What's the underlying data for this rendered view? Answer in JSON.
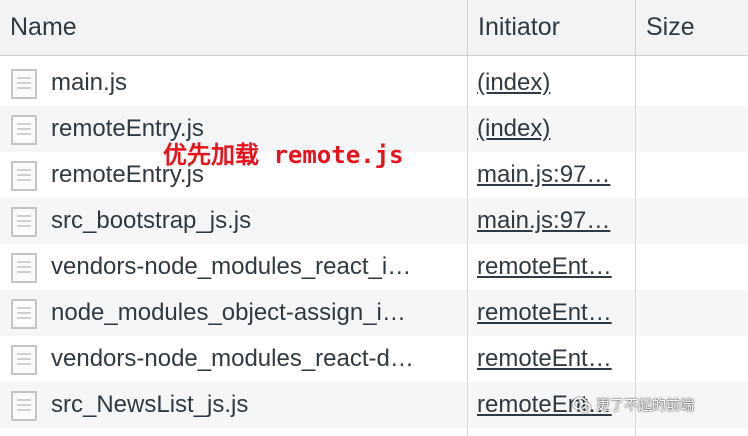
{
  "columns": {
    "name": "Name",
    "initiator": "Initiator",
    "size": "Size"
  },
  "rows": [
    {
      "name": "main.js",
      "initiator": "(index)",
      "size": ""
    },
    {
      "name": "remoteEntry.js",
      "initiator": "(index)",
      "size": ""
    },
    {
      "name": "remoteEntry.js",
      "initiator": "main.js:97…",
      "size": ""
    },
    {
      "name": "src_bootstrap_js.js",
      "initiator": "main.js:97…",
      "size": ""
    },
    {
      "name": "vendors-node_modules_react_i…",
      "initiator": "remoteEnt…",
      "size": ""
    },
    {
      "name": "node_modules_object-assign_i…",
      "initiator": "remoteEnt…",
      "size": ""
    },
    {
      "name": "vendors-node_modules_react-d…",
      "initiator": "remoteEnt…",
      "size": ""
    },
    {
      "name": "src_NewsList_js.js",
      "initiator": "remoteEnt…",
      "size": ""
    }
  ],
  "annotation": {
    "text": "优先加载 remote.js",
    "color": "#e8121b"
  },
  "watermark": {
    "text": "更了不起的前端",
    "icon": "wechat-icon"
  },
  "icons": {
    "file": "document-icon"
  }
}
